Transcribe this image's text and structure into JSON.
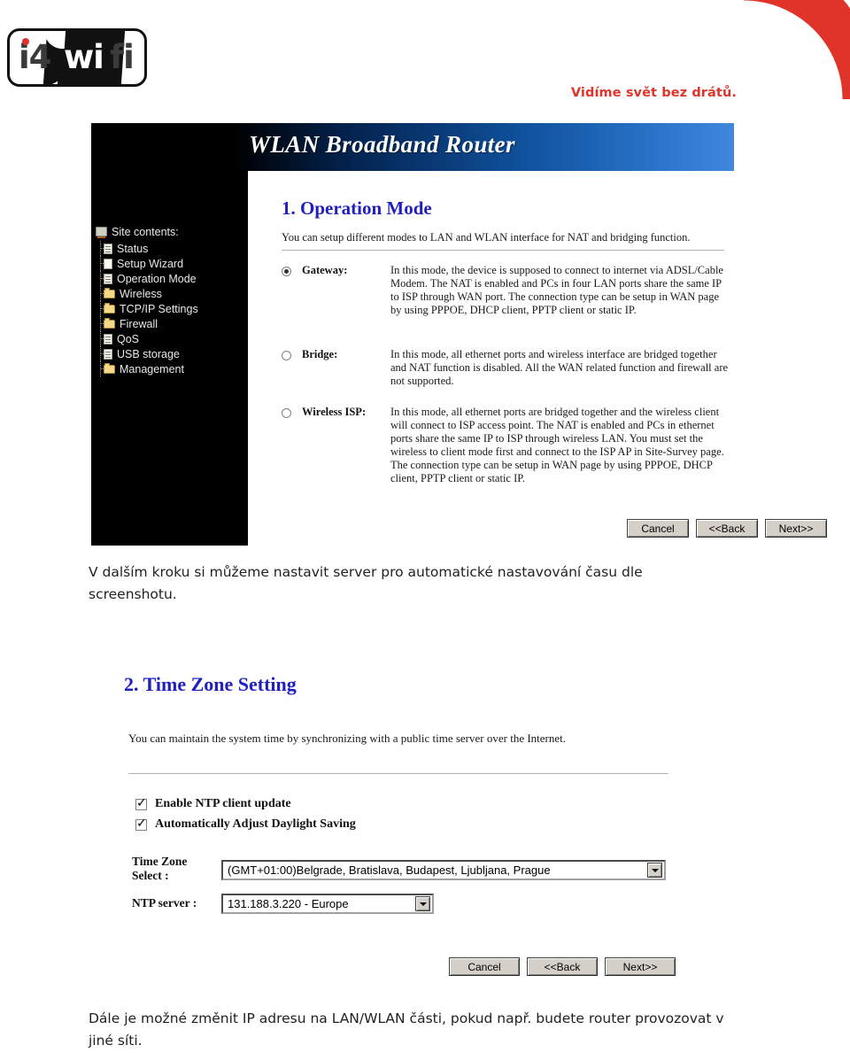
{
  "brand": {
    "logo_alt": "i4wifi",
    "logo_part1": "i4",
    "logo_part2": "wi",
    "logo_part3": "fi",
    "tagline": "Vidíme svět bez drátů.",
    "accent_red": "#e0342a",
    "logo_dark": "#111111"
  },
  "screenshot1": {
    "titlebar": "WLAN Broadband Router",
    "sidebar": {
      "root_label": "Site contents:",
      "items": [
        {
          "label": "Status",
          "icon": "document-icon"
        },
        {
          "label": "Setup Wizard",
          "icon": "document-icon"
        },
        {
          "label": "Operation Mode",
          "icon": "document-icon"
        },
        {
          "label": "Wireless",
          "icon": "folder-icon"
        },
        {
          "label": "TCP/IP Settings",
          "icon": "folder-icon"
        },
        {
          "label": "Firewall",
          "icon": "folder-icon"
        },
        {
          "label": "QoS",
          "icon": "document-icon"
        },
        {
          "label": "USB storage",
          "icon": "document-icon"
        },
        {
          "label": "Management",
          "icon": "folder-icon"
        }
      ]
    },
    "heading": "1. Operation Mode",
    "description": "You can setup different modes to LAN and WLAN interface for NAT and bridging function.",
    "modes": [
      {
        "name": "Gateway:",
        "selected": true,
        "text": "In this mode, the device is supposed to connect to internet via ADSL/Cable Modem. The NAT is enabled and PCs in four LAN ports share the same IP to ISP through WAN port. The connection type can be setup in WAN page by using PPPOE, DHCP client, PPTP client or static IP."
      },
      {
        "name": "Bridge:",
        "selected": false,
        "text": "In this mode, all ethernet ports and wireless interface are bridged together and NAT function is disabled. All the WAN related function and firewall are not supported."
      },
      {
        "name": "Wireless ISP:",
        "selected": false,
        "text": "In this mode, all ethernet ports are bridged together and the wireless client will connect to ISP access point. The NAT is enabled and PCs in ethernet ports share the same IP to ISP through wireless LAN. You must set the wireless to client mode first and connect to the ISP AP in Site-Survey page. The connection type can be setup in WAN page by using PPPOE, DHCP client, PPTP client or static IP."
      }
    ],
    "buttons": {
      "cancel": "Cancel",
      "back": "<<Back",
      "next": "Next>>"
    }
  },
  "body_text_1": "V dalším kroku si můžeme nastavit server pro automatické nastavování času dle screenshotu.",
  "screenshot2": {
    "heading": "2. Time Zone Setting",
    "description": "You can maintain the system time by synchronizing with a public time server over the Internet.",
    "checkboxes": [
      {
        "label": "Enable NTP client update",
        "checked": true
      },
      {
        "label": "Automatically Adjust Daylight Saving",
        "checked": true
      }
    ],
    "timezone_label_line1": "Time Zone",
    "timezone_label_line2": "Select :",
    "timezone_value": "(GMT+01:00)Belgrade, Bratislava, Budapest, Ljubljana, Prague",
    "ntp_label": "NTP server :",
    "ntp_value": "131.188.3.220 - Europe",
    "buttons": {
      "cancel": "Cancel",
      "back": "<<Back",
      "next": "Next>>"
    }
  },
  "body_text_2": "Dále je možné změnit IP adresu na LAN/WLAN části, pokud např. budete router provozovat v jiné síti."
}
